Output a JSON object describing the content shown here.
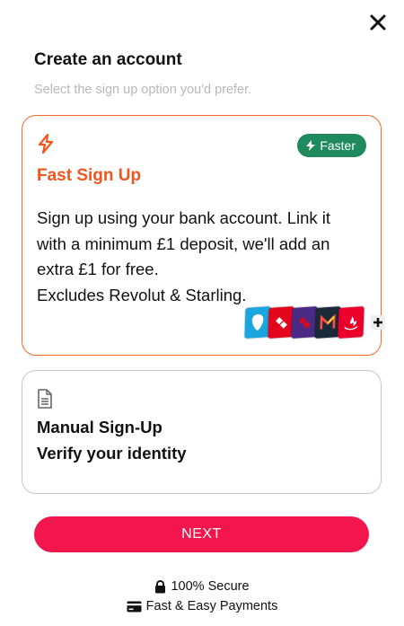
{
  "header": {
    "title": "Create an account",
    "subtitle": "Select the sign up option you'd prefer."
  },
  "fast_signup": {
    "badge": "Faster",
    "title": "Fast Sign Up",
    "description_lines": [
      "Sign up using your bank account. Link it",
      "with a minimum £1 deposit, we'll add an",
      "extra £1 for free.",
      "Excludes Revolut & Starling."
    ],
    "bank_icons": [
      "barclays-icon",
      "natwest-icon",
      "natwest-purple-icon",
      "monzo-icon",
      "santander-icon"
    ],
    "more_icon": "plus-icon",
    "accent": "#f0551e",
    "badge_color": "#1e8a5e"
  },
  "manual_signup": {
    "title": "Manual Sign-Up",
    "subtitle": "Verify your identity",
    "icon": "document-icon"
  },
  "next_button": {
    "label": "NEXT",
    "color": "#f2164c"
  },
  "footer": {
    "secure": "100% Secure",
    "payments": "Fast & Easy Payments"
  }
}
